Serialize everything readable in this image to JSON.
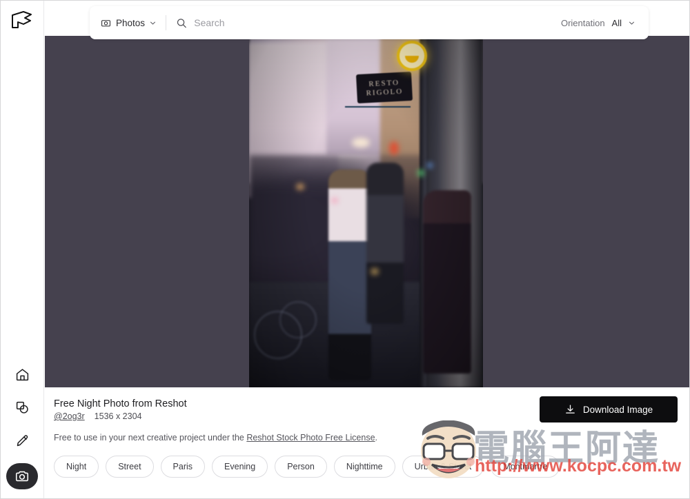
{
  "app": {
    "logo_alt": "reshot-logo"
  },
  "sidebar": {
    "items": [
      {
        "name": "home-icon",
        "label": "Home"
      },
      {
        "name": "shapes-icon",
        "label": "Graphics"
      },
      {
        "name": "pencil-icon",
        "label": "Edit"
      },
      {
        "name": "camera-icon",
        "label": "Photos",
        "active": true
      }
    ]
  },
  "search": {
    "category_label": "Photos",
    "category_icon": "camera-icon",
    "search_icon": "search-icon",
    "placeholder": "Search",
    "value": "",
    "filter_label": "Orientation",
    "filter_value": "All",
    "chevron_icon": "chevron-down-icon"
  },
  "photo": {
    "alt": "Night street scene in Montmartre Paris at dusk",
    "sign_line1": "RESTO",
    "sign_line2": "RIGOLO",
    "backdrop_color": "#45414e"
  },
  "info": {
    "title": "Free Night Photo from Reshot",
    "handle": "@2og3r",
    "dimensions": "1536 x 2304",
    "license_prefix": "Free to use in your next creative project under the ",
    "license_link": "Reshot Stock Photo Free License",
    "license_suffix": ".",
    "download_label": "Download Image",
    "download_icon": "download-icon"
  },
  "tags": [
    {
      "label": "Night"
    },
    {
      "label": "Street"
    },
    {
      "label": "Paris"
    },
    {
      "label": "Evening"
    },
    {
      "label": "Person"
    },
    {
      "label": "Nighttime"
    },
    {
      "label": "Urban & Street"
    },
    {
      "label": "Montmartre"
    }
  ],
  "watermark": {
    "text": "電腦王阿達",
    "url": "http://www.kocpc.com.tw",
    "text_color": "#969ea8",
    "url_color": "#e23a30"
  }
}
